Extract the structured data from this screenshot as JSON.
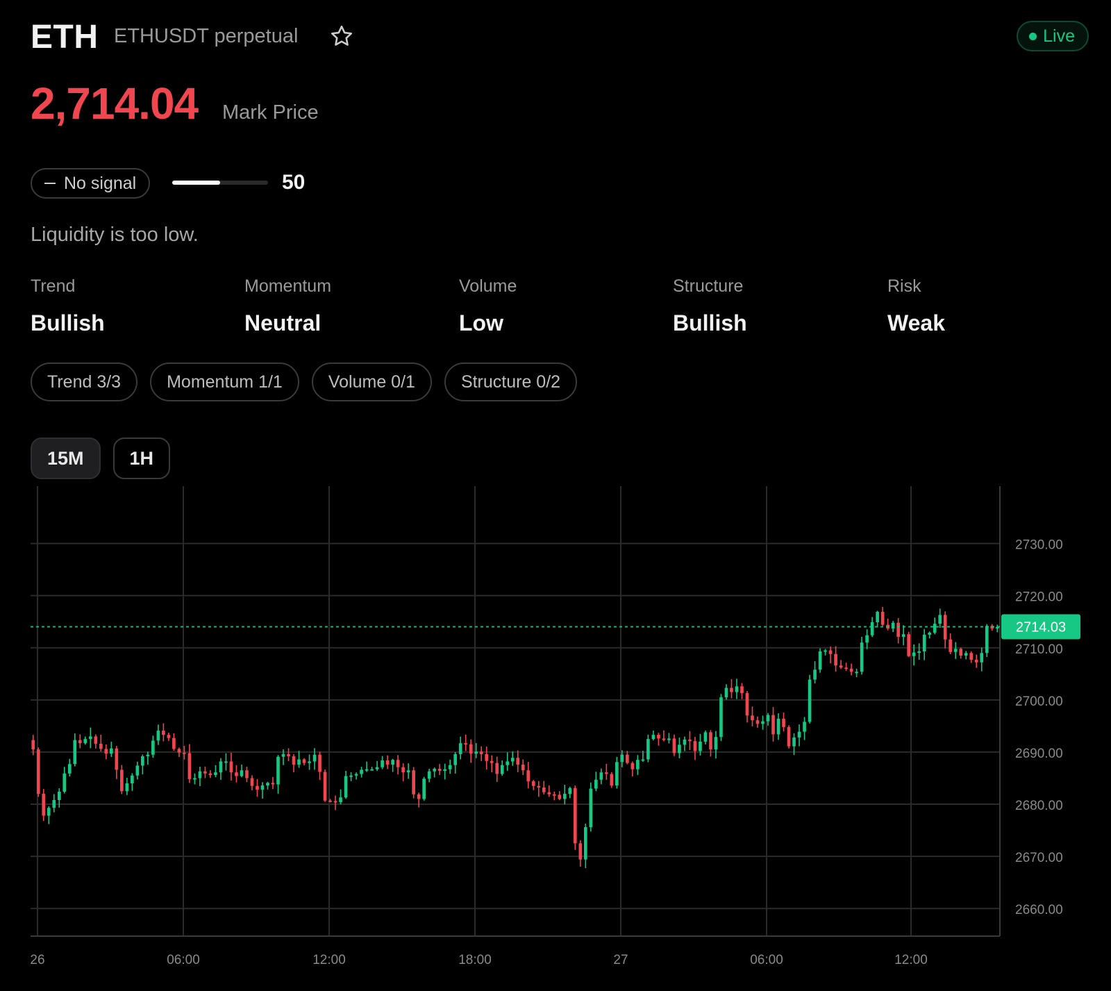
{
  "header": {
    "symbol": "ETH",
    "pair": "ETHUSDT perpetual",
    "live_label": "Live",
    "favorite_icon": "star-outline-icon",
    "live_dot_color": "#17c784"
  },
  "price": {
    "value": "2,714.04",
    "label": "Mark Price",
    "color": "#f0464f"
  },
  "signal": {
    "label": "No signal",
    "icon": "dash-icon",
    "score": 50,
    "score_max": 100
  },
  "note": "Liquidity is too low.",
  "metrics": [
    {
      "label": "Trend",
      "value": "Bullish"
    },
    {
      "label": "Momentum",
      "value": "Neutral"
    },
    {
      "label": "Volume",
      "value": "Low"
    },
    {
      "label": "Structure",
      "value": "Bullish"
    },
    {
      "label": "Risk",
      "value": "Weak"
    }
  ],
  "chips": [
    "Trend 3/3",
    "Momentum 1/1",
    "Volume 0/1",
    "Structure 0/2"
  ],
  "timeframes": [
    {
      "label": "15M",
      "active": true
    },
    {
      "label": "1H",
      "active": false
    }
  ],
  "chart_data": {
    "type": "candlestick",
    "interval": "15M",
    "x_tick_labels": [
      "26",
      "06:00",
      "12:00",
      "18:00",
      "27",
      "06:00",
      "12:00"
    ],
    "y_tick_labels": [
      "2730.00",
      "2720.00",
      "2710.00",
      "2700.00",
      "2690.00",
      "2680.00",
      "2670.00",
      "2660.00"
    ],
    "y_ticks": [
      2730,
      2720,
      2710,
      2700,
      2690,
      2680,
      2670,
      2660
    ],
    "ylim": [
      2654.7,
      2738.6
    ],
    "last_price": 2714.03,
    "last_price_label": "2714.03",
    "grid": true,
    "up_color": "#17c784",
    "down_color": "#f0464f",
    "closes": [
      2690.5,
      2682.0,
      2677.8,
      2679.3,
      2680.8,
      2682.4,
      2685.9,
      2687.7,
      2692.3,
      2691.7,
      2692.5,
      2693.0,
      2691.6,
      2690.6,
      2689.7,
      2690.7,
      2686.6,
      2682.5,
      2684.0,
      2685.5,
      2687.4,
      2689.2,
      2689.5,
      2692.2,
      2694.1,
      2693.3,
      2692.7,
      2690.6,
      2689.9,
      2689.8,
      2684.8,
      2685.0,
      2686.3,
      2685.9,
      2685.6,
      2686.1,
      2688.2,
      2688.2,
      2686.1,
      2685.4,
      2686.5,
      2685.0,
      2683.5,
      2682.8,
      2683.6,
      2684.1,
      2683.8,
      2689.1,
      2689.6,
      2689.2,
      2687.6,
      2688.6,
      2687.9,
      2688.2,
      2689.5,
      2686.2,
      2680.7,
      2680.6,
      2680.4,
      2681.3,
      2685.4,
      2685.5,
      2685.8,
      2686.6,
      2686.7,
      2686.7,
      2687.1,
      2688.4,
      2687.6,
      2688.5,
      2687.1,
      2686.1,
      2686.5,
      2681.9,
      2681.0,
      2684.9,
      2686.3,
      2686.8,
      2686.4,
      2686.7,
      2687.5,
      2689.6,
      2691.7,
      2691.5,
      2689.7,
      2690.1,
      2689.6,
      2688.3,
      2687.9,
      2685.8,
      2687.5,
      2688.2,
      2688.9,
      2687.6,
      2686.5,
      2684.4,
      2683.5,
      2683.2,
      2682.3,
      2681.9,
      2681.8,
      2681.0,
      2682.0,
      2683.1,
      2672.5,
      2669.4,
      2675.6,
      2683.0,
      2684.7,
      2686.1,
      2685.8,
      2683.6,
      2688.1,
      2689.5,
      2687.9,
      2686.7,
      2688.5,
      2688.6,
      2692.5,
      2693.3,
      2692.6,
      2692.3,
      2692.6,
      2689.8,
      2691.4,
      2692.4,
      2692.1,
      2690.2,
      2692.0,
      2693.8,
      2690.5,
      2692.9,
      2700.5,
      2702.3,
      2701.5,
      2702.6,
      2701.3,
      2697.0,
      2696.1,
      2695.4,
      2695.9,
      2697.1,
      2693.4,
      2696.4,
      2694.8,
      2691.1,
      2692.8,
      2693.9,
      2695.8,
      2703.9,
      2705.8,
      2709.3,
      2709.5,
      2708.8,
      2706.6,
      2706.2,
      2706.0,
      2705.4,
      2705.4,
      2711.0,
      2712.4,
      2714.9,
      2716.9,
      2714.4,
      2713.7,
      2714.8,
      2712.1,
      2712.6,
      2708.4,
      2709.1,
      2709.3,
      2712.5,
      2712.9,
      2714.6,
      2716.3,
      2711.6,
      2709.2,
      2709.8,
      2708.5,
      2709.0,
      2707.7,
      2707.2,
      2709.0,
      2714.2,
      2713.7,
      2714.0
    ]
  }
}
